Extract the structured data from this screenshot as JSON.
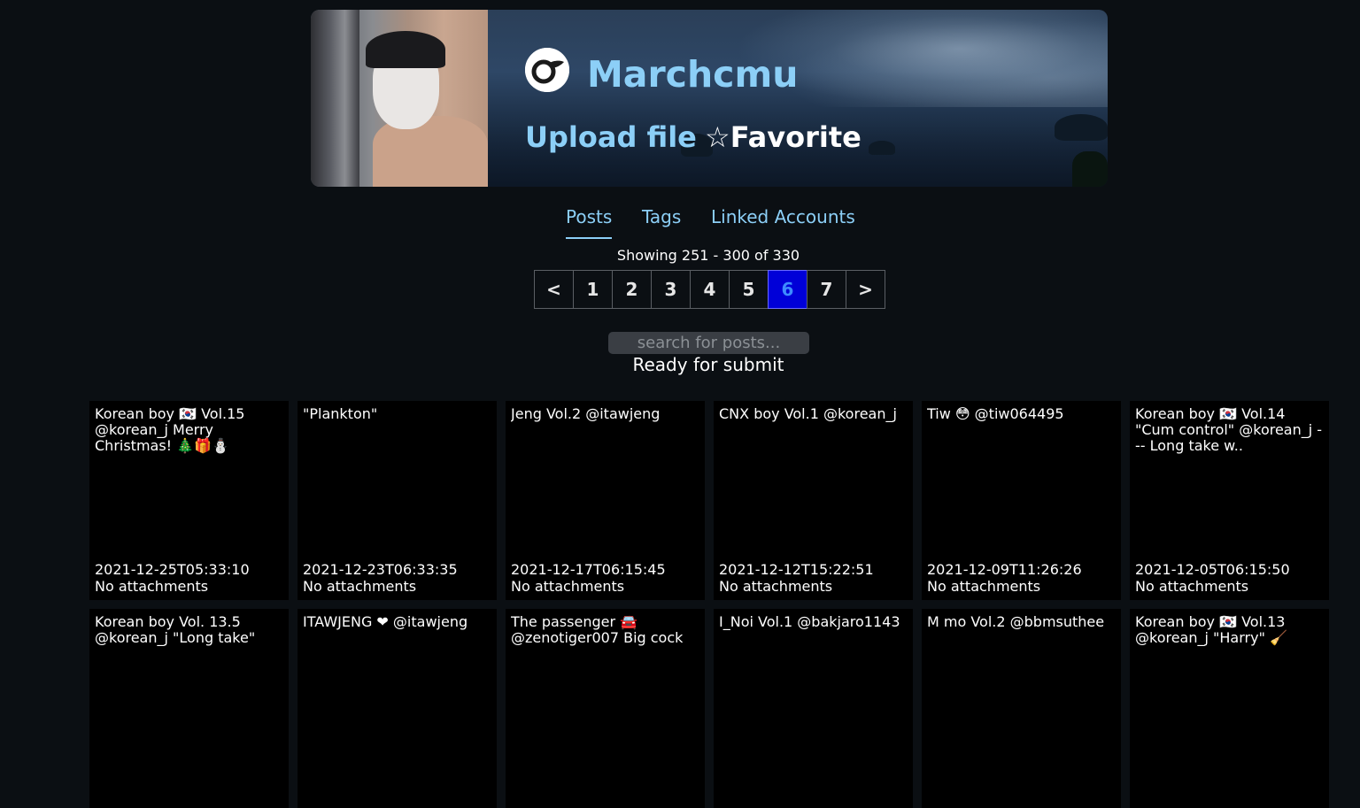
{
  "profile": {
    "username": "Marchcmu",
    "upload_label": "Upload file",
    "favorite_label": "☆Favorite",
    "brand_icon": "onlyfans-icon"
  },
  "tabs": [
    {
      "label": "Posts",
      "active": true
    },
    {
      "label": "Tags",
      "active": false
    },
    {
      "label": "Linked Accounts",
      "active": false
    }
  ],
  "pagination": {
    "showing": "Showing 251 - 300 of 330",
    "prev": "<",
    "next": ">",
    "pages": [
      "1",
      "2",
      "3",
      "4",
      "5",
      "6",
      "7"
    ],
    "current": "6"
  },
  "search": {
    "placeholder": "search for posts...",
    "status": "Ready for submit"
  },
  "posts": [
    {
      "title": "Korean boy 🇰🇷 Vol.15 @korean_j Merry Christmas! 🎄🎁⛄",
      "date": "2021-12-25T05:33:10",
      "attachments": "No attachments"
    },
    {
      "title": "\"Plankton\"",
      "date": "2021-12-23T06:33:35",
      "attachments": "No attachments"
    },
    {
      "title": "Jeng Vol.2 @itawjeng",
      "date": "2021-12-17T06:15:45",
      "attachments": "No attachments"
    },
    {
      "title": "CNX boy Vol.1 @korean_j",
      "date": "2021-12-12T15:22:51",
      "attachments": "No attachments"
    },
    {
      "title": "Tiw 😳 @tiw064495",
      "date": "2021-12-09T11:26:26",
      "attachments": "No attachments"
    },
    {
      "title": "Korean boy 🇰🇷 Vol.14 \"Cum control\" @korean_j --- Long take w..",
      "date": "2021-12-05T06:15:50",
      "attachments": "No attachments"
    },
    {
      "title": "Korean boy Vol. 13.5 @korean_j \"Long take\"",
      "date": "",
      "attachments": ""
    },
    {
      "title": "ITAWJENG ❤ @itawjeng",
      "date": "",
      "attachments": ""
    },
    {
      "title": "The passenger 🚘 @zenotiger007 Big cock",
      "date": "",
      "attachments": ""
    },
    {
      "title": "I_Noi Vol.1 @bakjaro1143",
      "date": "",
      "attachments": ""
    },
    {
      "title": "M mo Vol.2 @bbmsuthee",
      "date": "",
      "attachments": ""
    },
    {
      "title": "Korean boy 🇰🇷 Vol.13 @korean_j \"Harry\" 🧹",
      "date": "",
      "attachments": ""
    }
  ],
  "colors": {
    "background": "#0b0f13",
    "accent": "#8ccff7",
    "current_page_bg": "#0000d8",
    "card_bg": "#000000"
  }
}
